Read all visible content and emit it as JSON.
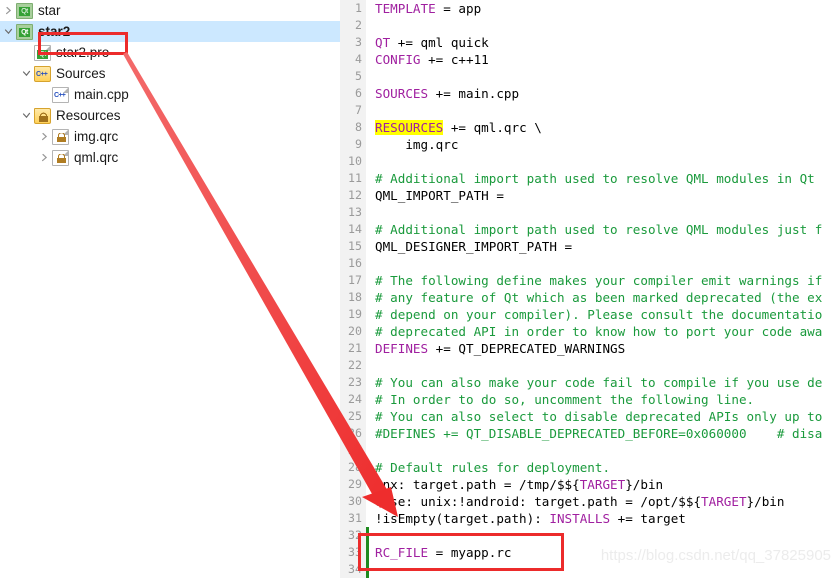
{
  "colors": {
    "annotation_red": "#ec2b2b",
    "selection_blue": "#cce8ff",
    "keyword_purple": "#a020a0",
    "comment_green": "#1a9a3c",
    "highlight_yellow": "#ffff00",
    "change_bar_green": "#1f8a1f",
    "gutter_gray": "#f2f2f2",
    "line_number_gray": "#9a9a9a",
    "watermark_gray": "#ececec"
  },
  "tree": {
    "name": "project-tree",
    "items": [
      {
        "label": "star",
        "icon": "qt-project-icon",
        "indent": 0,
        "twisty": "closed",
        "selected": false,
        "bold": false
      },
      {
        "label": "star2",
        "icon": "qt-project-icon",
        "indent": 0,
        "twisty": "open",
        "selected": true,
        "bold": true
      },
      {
        "label": "star2.pro",
        "icon": "qt-pro-file-icon",
        "indent": 1,
        "twisty": "none",
        "selected": false,
        "bold": false
      },
      {
        "label": "Sources",
        "icon": "cpp-folder-icon",
        "indent": 1,
        "twisty": "open",
        "selected": false,
        "bold": false
      },
      {
        "label": "main.cpp",
        "icon": "cpp-file-icon",
        "indent": 2,
        "twisty": "none",
        "selected": false,
        "bold": false
      },
      {
        "label": "Resources",
        "icon": "resource-folder-icon",
        "indent": 1,
        "twisty": "open",
        "selected": false,
        "bold": false
      },
      {
        "label": "img.qrc",
        "icon": "qrc-file-icon",
        "indent": 2,
        "twisty": "closed",
        "selected": false,
        "bold": false
      },
      {
        "label": "qml.qrc",
        "icon": "qrc-file-icon",
        "indent": 2,
        "twisty": "closed",
        "selected": false,
        "bold": false
      }
    ]
  },
  "annotations": {
    "pro_file_box": {
      "name": "red-highlight-box-star2-pro"
    },
    "rc_file_box": {
      "name": "red-highlight-box-rc-file"
    },
    "arrow": {
      "name": "red-arrow-annotation"
    }
  },
  "watermark": {
    "text": "https://blog.csdn.net/qq_37825905"
  },
  "editor": {
    "name": "code-editor",
    "language": "qmake-pro",
    "lines": [
      {
        "n": 1,
        "changed": false,
        "tokens": [
          {
            "t": "TEMPLATE",
            "c": "kw"
          },
          {
            "t": " = app",
            "c": "plain"
          }
        ]
      },
      {
        "n": 2,
        "changed": false,
        "tokens": []
      },
      {
        "n": 3,
        "changed": false,
        "tokens": [
          {
            "t": "QT",
            "c": "kw"
          },
          {
            "t": " += qml quick",
            "c": "plain"
          }
        ]
      },
      {
        "n": 4,
        "changed": false,
        "tokens": [
          {
            "t": "CONFIG",
            "c": "kw"
          },
          {
            "t": " += c++11",
            "c": "plain"
          }
        ]
      },
      {
        "n": 5,
        "changed": false,
        "tokens": []
      },
      {
        "n": 6,
        "changed": false,
        "tokens": [
          {
            "t": "SOURCES",
            "c": "kw"
          },
          {
            "t": " += main.cpp",
            "c": "plain"
          }
        ]
      },
      {
        "n": 7,
        "changed": false,
        "tokens": []
      },
      {
        "n": 8,
        "changed": false,
        "tokens": [
          {
            "t": "RESOURCES",
            "c": "hl"
          },
          {
            "t": " += qml.qrc \\",
            "c": "plain"
          }
        ]
      },
      {
        "n": 9,
        "changed": false,
        "tokens": [
          {
            "t": "    img.qrc",
            "c": "plain"
          }
        ]
      },
      {
        "n": 10,
        "changed": false,
        "tokens": []
      },
      {
        "n": 11,
        "changed": false,
        "tokens": [
          {
            "t": "# Additional import path used to resolve QML modules in Qt",
            "c": "com"
          }
        ]
      },
      {
        "n": 12,
        "changed": false,
        "tokens": [
          {
            "t": "QML_IMPORT_PATH =",
            "c": "plain"
          }
        ]
      },
      {
        "n": 13,
        "changed": false,
        "tokens": []
      },
      {
        "n": 14,
        "changed": false,
        "tokens": [
          {
            "t": "# Additional import path used to resolve QML modules just f",
            "c": "com"
          }
        ]
      },
      {
        "n": 15,
        "changed": false,
        "tokens": [
          {
            "t": "QML_DESIGNER_IMPORT_PATH =",
            "c": "plain"
          }
        ]
      },
      {
        "n": 16,
        "changed": false,
        "tokens": []
      },
      {
        "n": 17,
        "changed": false,
        "tokens": [
          {
            "t": "# The following define makes your compiler emit warnings if",
            "c": "com"
          }
        ]
      },
      {
        "n": 18,
        "changed": false,
        "tokens": [
          {
            "t": "# any feature of Qt which as been marked deprecated (the ex",
            "c": "com"
          }
        ]
      },
      {
        "n": 19,
        "changed": false,
        "tokens": [
          {
            "t": "# depend on your compiler). Please consult the documentatio",
            "c": "com"
          }
        ]
      },
      {
        "n": 20,
        "changed": false,
        "tokens": [
          {
            "t": "# deprecated API in order to know how to port your code awa",
            "c": "com"
          }
        ]
      },
      {
        "n": 21,
        "changed": false,
        "tokens": [
          {
            "t": "DEFINES",
            "c": "kw"
          },
          {
            "t": " += QT_DEPRECATED_WARNINGS",
            "c": "plain"
          }
        ]
      },
      {
        "n": 22,
        "changed": false,
        "tokens": []
      },
      {
        "n": 23,
        "changed": false,
        "tokens": [
          {
            "t": "# You can also make your code fail to compile if you use de",
            "c": "com"
          }
        ]
      },
      {
        "n": 24,
        "changed": false,
        "tokens": [
          {
            "t": "# In order to do so, uncomment the following line.",
            "c": "com"
          }
        ]
      },
      {
        "n": 25,
        "changed": false,
        "tokens": [
          {
            "t": "# You can also select to disable deprecated APIs only up to",
            "c": "com"
          }
        ]
      },
      {
        "n": 26,
        "changed": false,
        "tokens": [
          {
            "t": "#DEFINES += QT_DISABLE_DEPRECATED_BEFORE=0x060000    # disa",
            "c": "com"
          }
        ]
      },
      {
        "n": 27,
        "changed": false,
        "tokens": []
      },
      {
        "n": 28,
        "changed": false,
        "tokens": [
          {
            "t": "# Default rules for deployment.",
            "c": "com"
          }
        ]
      },
      {
        "n": 29,
        "changed": false,
        "tokens": [
          {
            "t": "qnx: target.path = /tmp/$${",
            "c": "plain"
          },
          {
            "t": "TARGET",
            "c": "kw"
          },
          {
            "t": "}/bin",
            "c": "plain"
          }
        ]
      },
      {
        "n": 30,
        "changed": false,
        "tokens": [
          {
            "t": "else: unix:!android: target.path = /opt/$${",
            "c": "plain"
          },
          {
            "t": "TARGET",
            "c": "kw"
          },
          {
            "t": "}/bin",
            "c": "plain"
          }
        ]
      },
      {
        "n": 31,
        "changed": false,
        "tokens": [
          {
            "t": "!isEmpty(target.path): ",
            "c": "plain"
          },
          {
            "t": "INSTALLS",
            "c": "kw"
          },
          {
            "t": " += target",
            "c": "plain"
          }
        ]
      },
      {
        "n": 32,
        "changed": true,
        "tokens": []
      },
      {
        "n": 33,
        "changed": true,
        "tokens": [
          {
            "t": "RC_FILE",
            "c": "kw"
          },
          {
            "t": " = myapp.rc",
            "c": "plain"
          }
        ]
      },
      {
        "n": 34,
        "changed": true,
        "tokens": []
      }
    ]
  }
}
